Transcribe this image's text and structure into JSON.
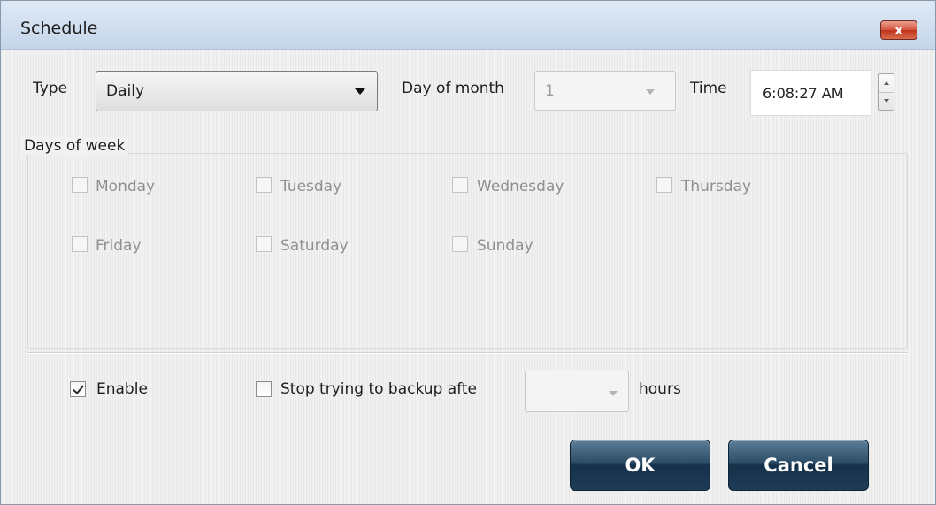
{
  "window": {
    "title": "Schedule",
    "close_glyph": "x",
    "close_icon": "close-icon"
  },
  "schedule": {
    "type_label": "Type",
    "type_value": "Daily",
    "day_of_month_label": "Day of month",
    "day_of_month_value": "1",
    "time_label": "Time",
    "time_value": "6:08:27 AM"
  },
  "days_of_week": {
    "title": "Days of week",
    "days": [
      {
        "label": "Monday",
        "checked": false,
        "enabled": false
      },
      {
        "label": "Tuesday",
        "checked": false,
        "enabled": false
      },
      {
        "label": "Wednesday",
        "checked": false,
        "enabled": false
      },
      {
        "label": "Thursday",
        "checked": false,
        "enabled": false
      },
      {
        "label": "Friday",
        "checked": false,
        "enabled": false
      },
      {
        "label": "Saturday",
        "checked": false,
        "enabled": false
      },
      {
        "label": "Sunday",
        "checked": false,
        "enabled": false
      }
    ]
  },
  "options": {
    "enable_label": "Enable",
    "enable_checked": true,
    "stop_label": "Stop trying to backup afte",
    "stop_checked": false,
    "hours_value": "",
    "hours_label": "hours"
  },
  "buttons": {
    "ok": "OK",
    "cancel": "Cancel"
  },
  "colors": {
    "title_bar": "#c4d6ea",
    "button": "#1f3c57",
    "close_button": "#c0331d",
    "disabled_text": "#8f8f8f"
  }
}
